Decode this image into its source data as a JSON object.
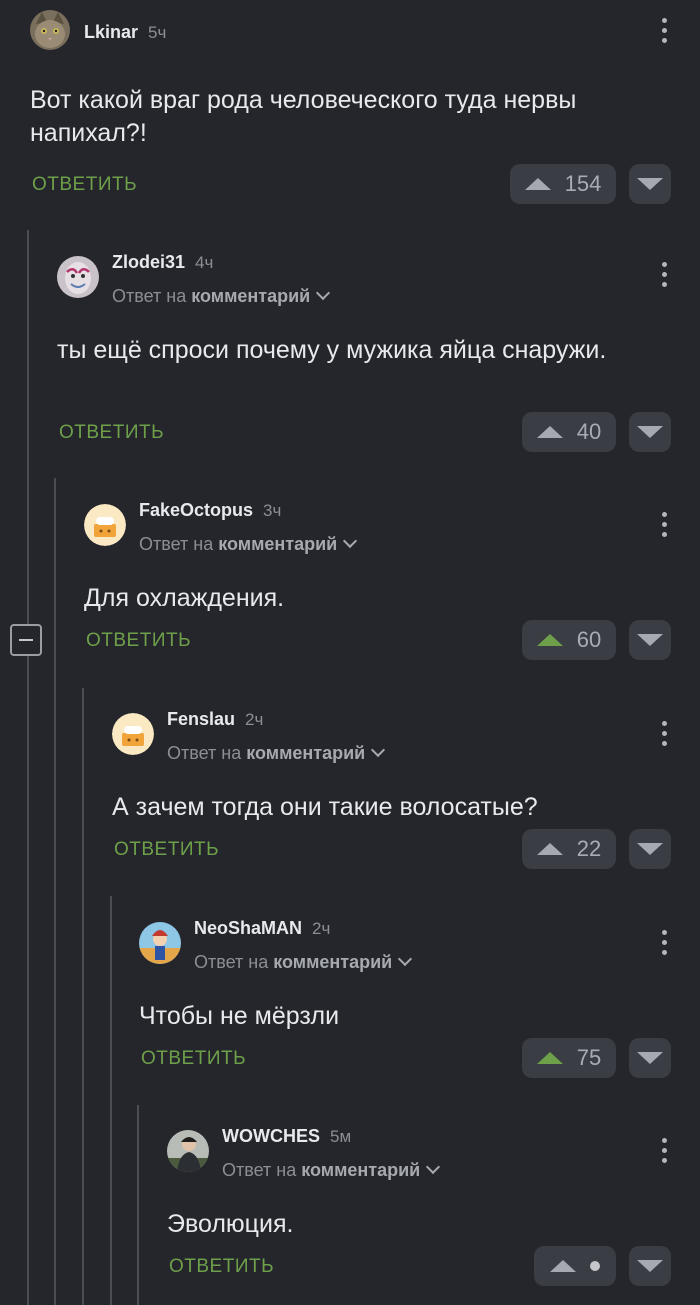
{
  "colors": {
    "background": "#24262b",
    "accent_green": "#6ea04a",
    "muted": "#8b8e95"
  },
  "labels": {
    "reply": "ОТВЕТИТЬ",
    "reply_to_prefix": "Ответ на",
    "reply_to_target": "комментарий"
  },
  "comments": [
    {
      "author": "Lkinar",
      "time": "5ч",
      "text": "Вот какой враг рода человеческого туда нервы напихал?!",
      "score": "154",
      "upvoted": false,
      "is_reply": false,
      "avatar": "cat-avatar"
    },
    {
      "author": "Zlodei31",
      "time": "4ч",
      "text": "ты ещё спроси почему у мужика яйца снаружи.",
      "score": "40",
      "upvoted": false,
      "is_reply": true,
      "avatar": "mask-avatar"
    },
    {
      "author": "FakeOctopus",
      "time": "3ч",
      "text": "Для охлаждения.",
      "score": "60",
      "upvoted": true,
      "is_reply": true,
      "avatar": "default-avatar"
    },
    {
      "author": "Fenslau",
      "time": "2ч",
      "text": "А зачем тогда они такие волосатые?",
      "score": "22",
      "upvoted": false,
      "is_reply": true,
      "avatar": "default-avatar"
    },
    {
      "author": "NeoShaMAN",
      "time": "2ч",
      "text": "Чтобы не мёрзли",
      "score": "75",
      "upvoted": true,
      "is_reply": true,
      "avatar": "cartoon-avatar"
    },
    {
      "author": "WOWCHES",
      "time": "5м",
      "text": "Эволюция.",
      "score": "",
      "upvoted": false,
      "is_reply": true,
      "avatar": "photo-avatar"
    }
  ]
}
